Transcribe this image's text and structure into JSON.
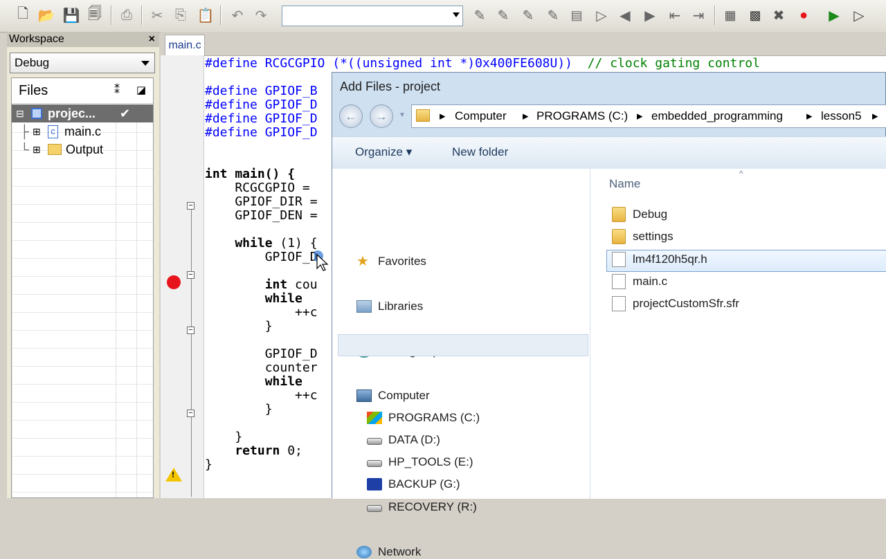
{
  "toolbar": {
    "icons": [
      "new-file-icon",
      "open-folder-icon",
      "save-icon",
      "save-all-icon",
      "print-icon",
      "cut-icon",
      "copy-icon",
      "paste-icon",
      "undo-icon",
      "redo-icon"
    ],
    "combo_value": "",
    "right_icons": [
      "toggle-bookmark-icon",
      "next-bookmark-icon",
      "prev-bookmark-icon",
      "clear-bookmarks-icon",
      "find-icon",
      "go-to-line-icon",
      "back-icon",
      "forward-icon",
      "indent-icon",
      "outdent-icon",
      "compile-icon",
      "make-icon",
      "stop-build-icon",
      "toggle-breakpoint-icon",
      "download-debug-icon",
      "debug-without-download-icon"
    ]
  },
  "workspace": {
    "title": "Workspace",
    "close": "×",
    "config": "Debug",
    "files_header": "Files",
    "tree": [
      {
        "label": "projec...",
        "check": "✔"
      },
      {
        "label": "main.c"
      },
      {
        "label": "Output"
      }
    ]
  },
  "editor": {
    "tab": "main.c",
    "lines": {
      "l0a": "#define RCGCGPIO (*((unsigned int *)0x400FE608U))",
      "l0b": "// clock gating control",
      "l1": "#define GPIOF_B",
      "l2": "#define GPIOF_D",
      "l3": "#define GPIOF_D",
      "l4": "#define GPIOF_D",
      "l5": "int main() {",
      "l6": "    RCGCGPIO =",
      "l7": "    GPIOF_DIR =",
      "l8": "    GPIOF_DEN =",
      "l9a": "    while",
      "l9b": " (1) {",
      "l10": "        GPIOF_D",
      "l11a": "        int",
      "l11b": " cou",
      "l12": "        while",
      "l13": "            ++c",
      "l14": "        }",
      "l15": "        GPIOF_D",
      "l16": "        counter",
      "l17": "        while",
      "l18": "            ++c",
      "l19": "        }",
      "l20": "    }",
      "l21a": "    return",
      "l21b": " 0;",
      "l22": "}"
    }
  },
  "dialog": {
    "title": "Add Files - project",
    "breadcrumb": [
      "Computer",
      "PROGRAMS (C:)",
      "embedded_programming",
      "lesson5"
    ],
    "sep": "▸",
    "back": "←",
    "forward": "→",
    "organize": "Organize ▾",
    "new_folder": "New folder",
    "nav": {
      "favorites": "Favorites",
      "libraries": "Libraries",
      "homegroup": "Homegroup",
      "computer": "Computer",
      "drives": [
        "PROGRAMS (C:)",
        "DATA (D:)",
        "HP_TOOLS (E:)",
        "BACKUP (G:)",
        "RECOVERY (R:)"
      ],
      "network": "Network"
    },
    "column": "Name",
    "sort": "^",
    "files": [
      {
        "name": "Debug",
        "type": "folder"
      },
      {
        "name": "settings",
        "type": "folder"
      },
      {
        "name": "lm4f120h5qr.h",
        "type": "file"
      },
      {
        "name": "main.c",
        "type": "file"
      },
      {
        "name": "projectCustomSfr.sfr",
        "type": "file"
      }
    ]
  },
  "colors": {
    "accent": "#cfe0f1",
    "breakpoint": "#e8141b",
    "preprocessor": "#0000ff",
    "comment": "#008000"
  }
}
